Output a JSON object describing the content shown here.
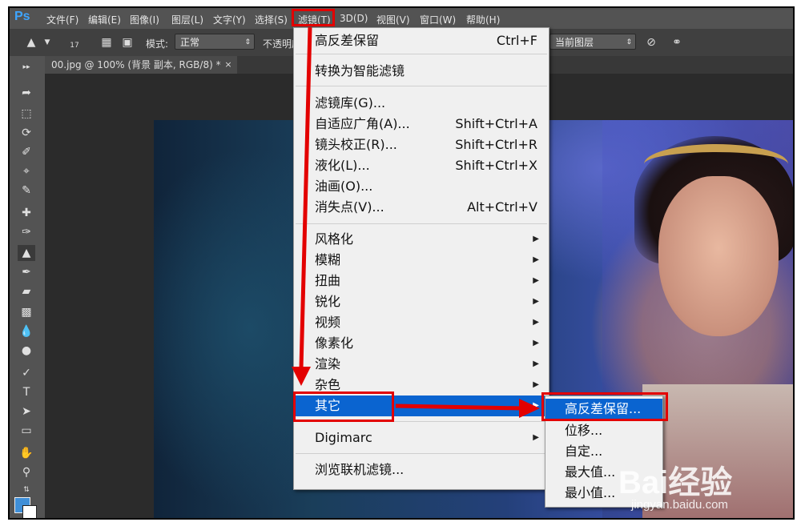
{
  "app": {
    "logo": "Ps"
  },
  "menubar": [
    "文件(F)",
    "编辑(E)",
    "图像(I)",
    "图层(L)",
    "文字(Y)",
    "选择(S)",
    "滤镜(T)",
    "3D(D)",
    "视图(V)",
    "窗口(W)",
    "帮助(H)"
  ],
  "options_bar": {
    "brush_size": "17",
    "mode_label": "模式:",
    "mode_value": "正常",
    "opacity_label": "不透明度",
    "sample_value": "当前图层"
  },
  "document_tab": {
    "title": "00.jpg @ 100% (背景 副本, RGB/8) *",
    "close": "×"
  },
  "filter_menu": {
    "items": [
      {
        "label": "高反差保留",
        "shortcut": "Ctrl+F"
      },
      {
        "label": "转换为智能滤镜",
        "shortcut": ""
      },
      {
        "label": "滤镜库(G)...",
        "shortcut": ""
      },
      {
        "label": "自适应广角(A)...",
        "shortcut": "Shift+Ctrl+A"
      },
      {
        "label": "镜头校正(R)...",
        "shortcut": "Shift+Ctrl+R"
      },
      {
        "label": "液化(L)...",
        "shortcut": "Shift+Ctrl+X"
      },
      {
        "label": "油画(O)...",
        "shortcut": ""
      },
      {
        "label": "消失点(V)...",
        "shortcut": "Alt+Ctrl+V"
      },
      {
        "label": "风格化",
        "submenu": true
      },
      {
        "label": "模糊",
        "submenu": true
      },
      {
        "label": "扭曲",
        "submenu": true
      },
      {
        "label": "锐化",
        "submenu": true
      },
      {
        "label": "视频",
        "submenu": true
      },
      {
        "label": "像素化",
        "submenu": true
      },
      {
        "label": "渲染",
        "submenu": true
      },
      {
        "label": "杂色",
        "submenu": true
      },
      {
        "label": "其它",
        "submenu": true,
        "highlighted": true
      },
      {
        "label": "Digimarc",
        "submenu": true
      },
      {
        "label": "浏览联机滤镜...",
        "shortcut": ""
      }
    ]
  },
  "other_submenu": {
    "items": [
      {
        "label": "高反差保留...",
        "highlighted": true
      },
      {
        "label": "位移..."
      },
      {
        "label": "自定..."
      },
      {
        "label": "最大值..."
      },
      {
        "label": "最小值..."
      }
    ]
  },
  "watermark": {
    "main": "Bai经验",
    "url": "jingyan.baidu.com"
  },
  "colors": {
    "accent": "#e30000",
    "highlight": "#0a64d0",
    "foreground_swatch": "#3f8fd8",
    "background_swatch": "#ffffff"
  },
  "icons": [
    "stamp-icon",
    "brush-preset-icon",
    "toggle-brush-panel-icon",
    "aligned-icon",
    "move-icon",
    "marquee-icon",
    "lasso-icon",
    "quick-select-icon",
    "crop-icon",
    "eyedropper-icon",
    "healing-icon",
    "brush-icon",
    "clone-stamp-icon",
    "history-brush-icon",
    "eraser-icon",
    "gradient-icon",
    "blur-icon",
    "dodge-icon",
    "pen-icon",
    "type-icon",
    "path-select-icon",
    "shape-icon",
    "hand-icon",
    "zoom-icon"
  ]
}
